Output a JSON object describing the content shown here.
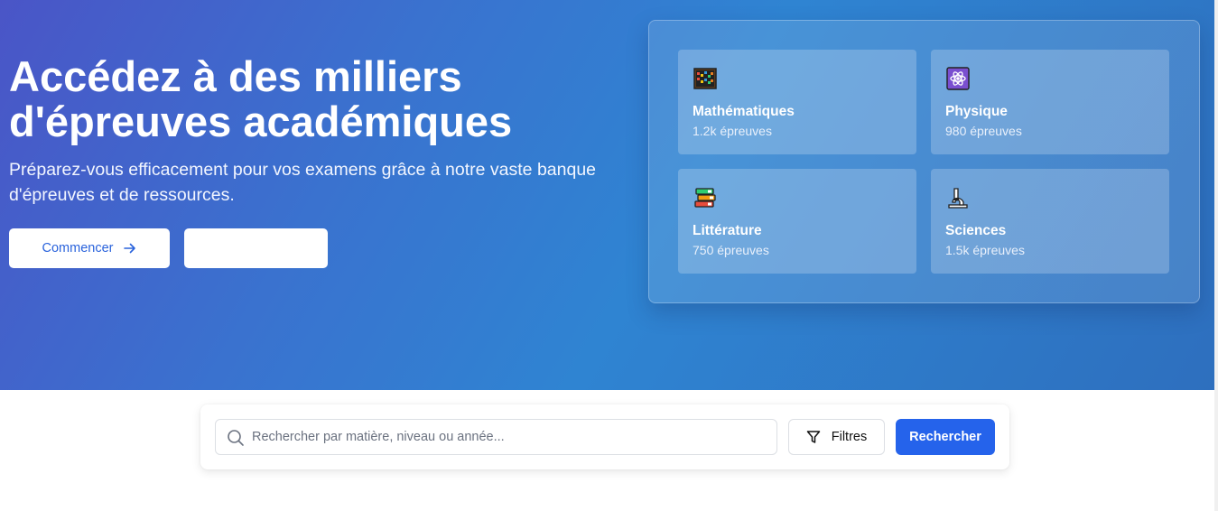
{
  "hero": {
    "title": "Accédez à des milliers d'épreuves académiques",
    "subtitle": "Préparez-vous efficacement pour vos examens grâce à notre vaste banque d'épreuves et de ressources.",
    "primary_button": "Commencer",
    "secondary_button": ""
  },
  "categories": [
    {
      "title": "Mathématiques",
      "count": "1.2k épreuves",
      "icon": "abacus-icon"
    },
    {
      "title": "Physique",
      "count": "980 épreuves",
      "icon": "atom-icon"
    },
    {
      "title": "Littérature",
      "count": "750 épreuves",
      "icon": "books-icon"
    },
    {
      "title": "Sciences",
      "count": "1.5k épreuves",
      "icon": "microscope-icon"
    }
  ],
  "search": {
    "placeholder": "Rechercher par matière, niveau ou année...",
    "value": "",
    "filter_label": "Filtres",
    "submit_label": "Rechercher"
  },
  "colors": {
    "accent": "#2563eb",
    "hero_gradient_start": "#4a55c7",
    "hero_gradient_end": "#2e6fbe"
  }
}
